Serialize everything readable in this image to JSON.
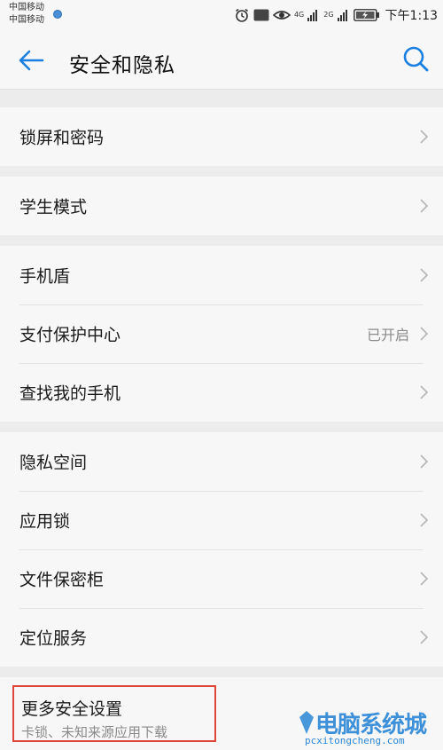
{
  "status_bar": {
    "carrier_1": "中国移动",
    "carrier_2": "中国移动",
    "icons": [
      "alarm-icon",
      "hd-icon",
      "eye-icon",
      "signal-4g-icon",
      "signal-2g-icon",
      "battery-charging-icon"
    ],
    "network_1": "4G",
    "network_2": "2G",
    "hd_label": "HD",
    "time": "下午1:13"
  },
  "app_bar": {
    "title": "安全和隐私",
    "back_icon": "back-arrow-icon",
    "search_icon": "search-icon",
    "accent_color": "#1a7fe0"
  },
  "groups": [
    {
      "items": [
        {
          "label": "锁屏和密码"
        }
      ]
    },
    {
      "items": [
        {
          "label": "学生模式"
        }
      ]
    },
    {
      "items": [
        {
          "label": "手机盾"
        },
        {
          "label": "支付保护中心",
          "value": "已开启"
        },
        {
          "label": "查找我的手机"
        }
      ]
    },
    {
      "items": [
        {
          "label": "隐私空间"
        },
        {
          "label": "应用锁"
        },
        {
          "label": "文件保密柜"
        },
        {
          "label": "定位服务"
        }
      ]
    }
  ],
  "more_settings": {
    "title": "更多安全设置",
    "subtitle": "卡锁、未知来源应用下载",
    "highlight_color": "#e0453c"
  },
  "watermark": {
    "text": "电脑系统城",
    "url": "pcxitongcheng.com"
  }
}
